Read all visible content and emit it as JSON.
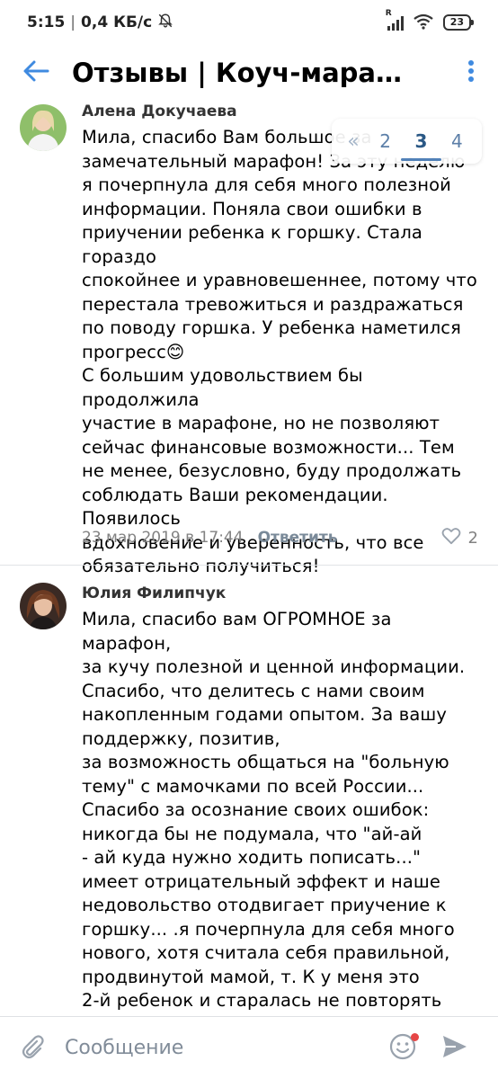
{
  "status_bar": {
    "time": "5:15",
    "network_speed": "0,4 КБ/с",
    "battery": "23"
  },
  "header": {
    "title": "Отзывы | Коуч-марафо..."
  },
  "pagination": {
    "pages": [
      "2",
      "3",
      "4"
    ],
    "active": "3"
  },
  "comments": [
    {
      "author": "Алена Докучаева",
      "text": "Мила, спасибо Вам большое за\nзамечательный марафон! За эту неделю\nя почерпнула для себя много полезной\nинформации. Поняла свои ошибки в\nприучении ребенка к горшку. Стала гораздо\nспокойнее и уравновешеннее, потому что\nперестала тревожиться и раздражаться\nпо поводу горшка. У ребенка наметился\nпрогресс😊\nС большим удовольствием бы продолжила\nучастие в марафоне, но не позволяют\nсейчас финансовые возможности... Тем\nне менее, безусловно, буду продолжать\nсоблюдать Ваши рекомендации. Появилось\nвдохновение и уверенность, что все\nобязательно получиться!",
      "date": "23 мар 2019 в 17:44",
      "reply_label": "Ответить",
      "likes": "2"
    },
    {
      "author": "Юлия Филипчук",
      "text": "Мила, спасибо вам ОГРОМНОЕ за марафон,\nза кучу полезной и ценной информации.\nСпасибо, что делитесь с нами своим\nнакопленным годами опытом. За вашу\nподдержку, позитив,\nза возможность общаться на \"больную\nтему\" с мамочками по всей России...\nСпасибо за осознание своих ошибок:\nникогда бы не подумала, что \"ай-ай\n- ай куда нужно ходить пописать...\"\nимеет отрицательный эффект и наше\nнедовольство отодвигает приучение к\nгоршку... .я почерпнула для себя много\nнового, хотя считала себя правильной,\nпродвинутой мамой, т. К у меня это\n2-й ребенок и старалась не повторять\nсвои ошибки, допущенные со старшей"
    }
  ],
  "input": {
    "placeholder": "Сообщение"
  },
  "colors": {
    "accent": "#3f8ae0",
    "meta": "#828282",
    "notification_dot": "#e64646"
  }
}
